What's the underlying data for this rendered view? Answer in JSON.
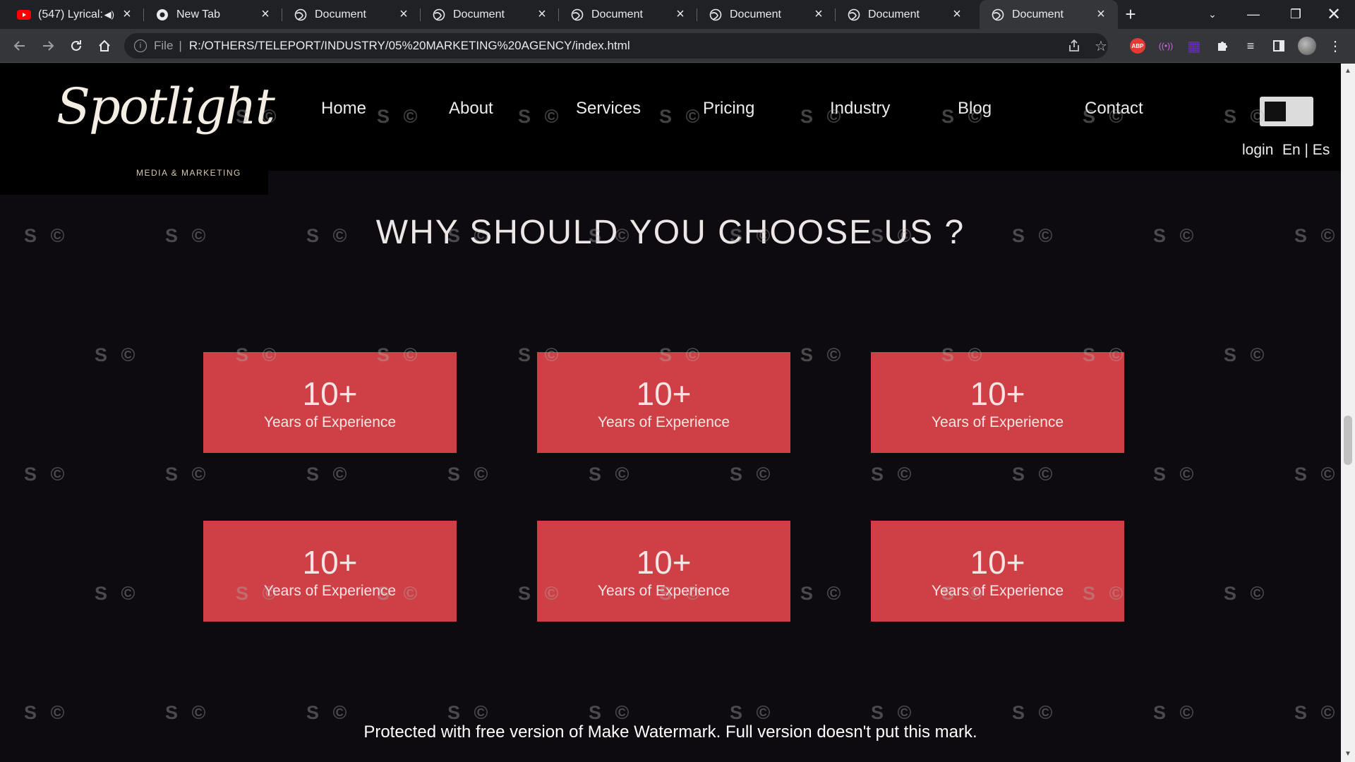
{
  "browser": {
    "tabs": [
      {
        "title": "(547) Lyrical: ",
        "icon": "youtube-icon",
        "muted": true
      },
      {
        "title": "New Tab",
        "icon": "chrome-icon"
      },
      {
        "title": "Document",
        "icon": "globe-icon"
      },
      {
        "title": "Document",
        "icon": "globe-icon"
      },
      {
        "title": "Document",
        "icon": "globe-icon"
      },
      {
        "title": "Document",
        "icon": "globe-icon"
      },
      {
        "title": "Document",
        "icon": "globe-icon"
      },
      {
        "title": "Document",
        "icon": "globe-icon",
        "active": true
      }
    ],
    "address": {
      "scheme_label": "File",
      "url": "R:/OTHERS/TELEPORT/INDUSTRY/05%20MARKETING%20AGENCY/index.html"
    },
    "extensions": [
      "ABP",
      "((•))",
      "▦"
    ]
  },
  "site": {
    "logo": {
      "script": "Spotlight",
      "tagline": "MEDIA & MARKETING"
    },
    "nav": [
      "Home",
      "About",
      "Services",
      "Pricing",
      "Industry",
      "Blog",
      "Contact"
    ],
    "login": "login",
    "lang": "En | Es",
    "section_title": "WHY SHOULD YOU CHOOSE US ?",
    "stats": [
      {
        "value": "10+",
        "label": "Years of Experience"
      },
      {
        "value": "10+",
        "label": "Years of Experience"
      },
      {
        "value": "10+",
        "label": "Years of Experience"
      },
      {
        "value": "10+",
        "label": "Years of Experience"
      },
      {
        "value": "10+",
        "label": "Years of Experience"
      },
      {
        "value": "10+",
        "label": "Years of Experience"
      }
    ],
    "watermark": "S ©",
    "protect_notice": "Protected with free version of Make Watermark. Full version doesn't put this mark."
  },
  "colors": {
    "accent_card": "#cf3f46",
    "page_bg": "#0d0a10",
    "header_bg": "#000000"
  }
}
